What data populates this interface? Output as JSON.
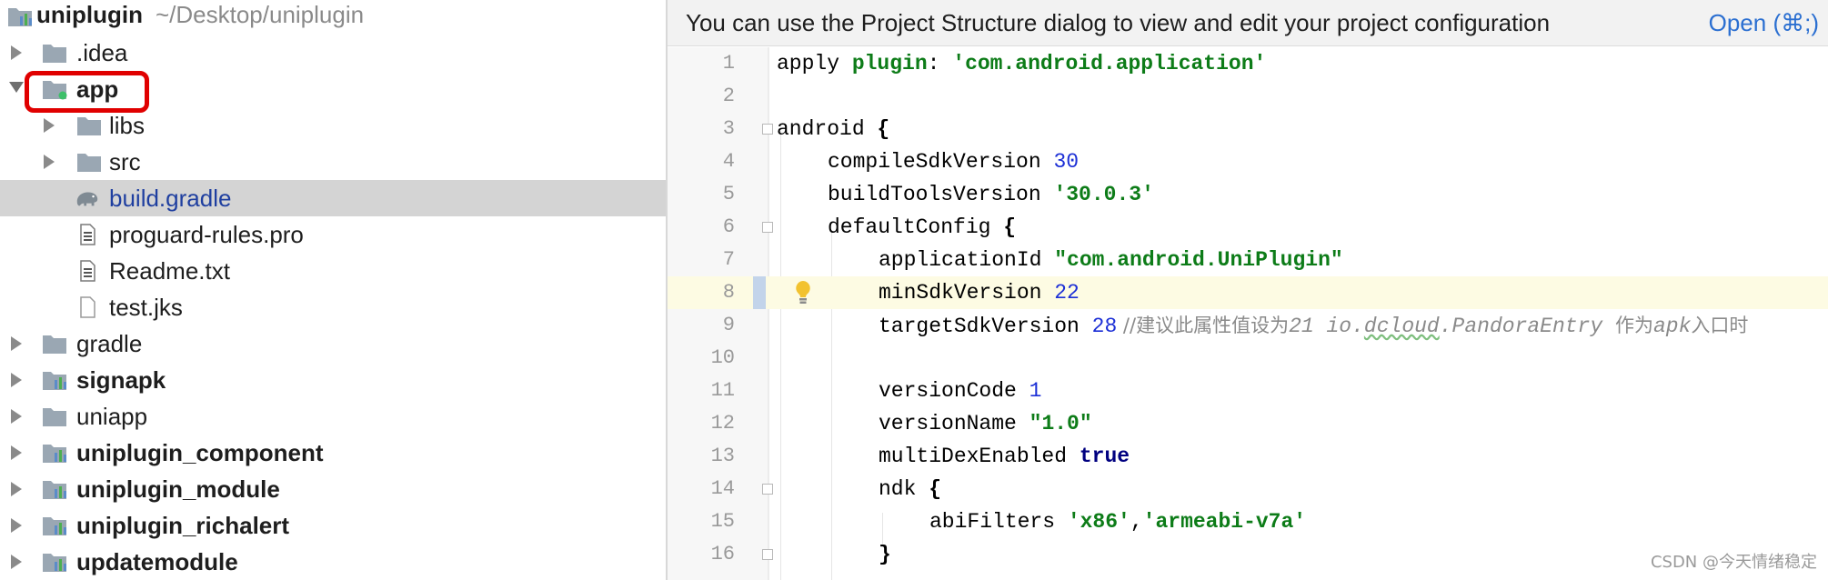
{
  "project_tree": {
    "root": {
      "name": "uniplugin",
      "path": "~/Desktop/uniplugin"
    },
    "items": [
      {
        "label": "uniplugin",
        "icon": "module-folder-icon"
      },
      {
        "label": ".idea",
        "icon": "folder-icon"
      },
      {
        "label": "app",
        "icon": "module-folder-icon"
      },
      {
        "label": "libs",
        "icon": "folder-icon"
      },
      {
        "label": "src",
        "icon": "folder-icon"
      },
      {
        "label": "build.gradle",
        "icon": "gradle-elephant-icon"
      },
      {
        "label": "proguard-rules.pro",
        "icon": "text-file-icon"
      },
      {
        "label": "Readme.txt",
        "icon": "text-file-icon"
      },
      {
        "label": "test.jks",
        "icon": "file-icon"
      },
      {
        "label": "gradle",
        "icon": "folder-icon"
      },
      {
        "label": "signapk",
        "icon": "module-folder-icon"
      },
      {
        "label": "uniapp",
        "icon": "folder-icon"
      },
      {
        "label": "uniplugin_component",
        "icon": "module-folder-icon"
      },
      {
        "label": "uniplugin_module",
        "icon": "module-folder-icon"
      },
      {
        "label": "uniplugin_richalert",
        "icon": "module-folder-icon"
      },
      {
        "label": "updatemodule",
        "icon": "module-folder-icon"
      }
    ]
  },
  "banner": {
    "text": "You can use the Project Structure dialog to view and edit your project configuration",
    "link": "Open (⌘;)"
  },
  "editor": {
    "line_numbers": [
      "1",
      "2",
      "3",
      "4",
      "5",
      "6",
      "7",
      "8",
      "9",
      "10",
      "11",
      "12",
      "13",
      "14",
      "15",
      "16"
    ],
    "current_line": 8,
    "code": {
      "l1_apply": "apply ",
      "l1_plugin": "plugin",
      "l1_colon": ": ",
      "l1_value": "'com.android.application'",
      "l3_android": "android ",
      "l3_brace": "{",
      "l4_key": "compileSdkVersion ",
      "l4_val": "30",
      "l5_key": "buildToolsVersion ",
      "l5_val": "'30.0.3'",
      "l6_key": "defaultConfig ",
      "l6_brace": "{",
      "l7_key": "applicationId ",
      "l7_val": "\"com.android.UniPlugin\"",
      "l8_key": "minSdkVersion ",
      "l8_val": "22",
      "l9_key": "targetSdkVersion ",
      "l9_val": "28",
      "l9_c1": " //建议此属性值设为",
      "l9_c2": "21 io.",
      "l9_c3": "dcloud",
      "l9_c4": ".PandoraEntry ",
      "l9_c5": "作为",
      "l9_c6": "apk",
      "l9_c7": "入口时",
      "l11_key": "versionCode ",
      "l11_val": "1",
      "l12_key": "versionName ",
      "l12_val": "\"1.0\"",
      "l13_key": "multiDexEnabled ",
      "l13_val": "true",
      "l14_key": "ndk ",
      "l14_brace": "{",
      "l15_key": "abiFilters ",
      "l15_v1": "'x86'",
      "l15_comma": ",",
      "l15_v2": "'armeabi-v7a'",
      "l16_brace": "}"
    }
  },
  "watermark": "CSDN @今天情绪稳定",
  "colors": {
    "selection": "#d4d4d4",
    "callout": "#e00000",
    "link": "#2b6fd1",
    "string": "#0d7c18",
    "number": "#1c2fd6",
    "current_line": "#fdfbe3"
  }
}
